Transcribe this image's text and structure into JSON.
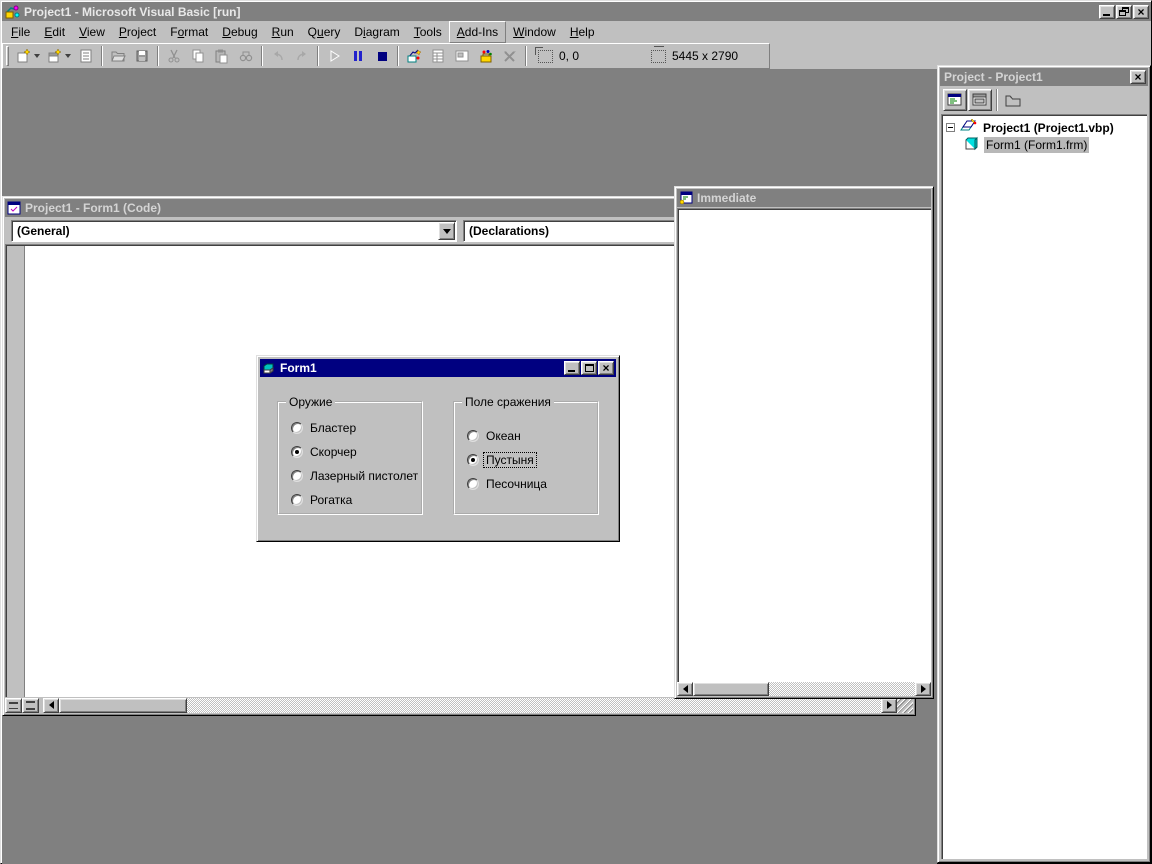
{
  "app": {
    "title": "Project1 - Microsoft Visual Basic [run]"
  },
  "menu": {
    "items": [
      {
        "label": "File",
        "underline": 0
      },
      {
        "label": "Edit",
        "underline": 0
      },
      {
        "label": "View",
        "underline": 0
      },
      {
        "label": "Project",
        "underline": 0
      },
      {
        "label": "Format",
        "underline": 1
      },
      {
        "label": "Debug",
        "underline": 0
      },
      {
        "label": "Run",
        "underline": 0
      },
      {
        "label": "Query",
        "underline": 1
      },
      {
        "label": "Diagram",
        "underline": 1
      },
      {
        "label": "Tools",
        "underline": 0
      },
      {
        "label": "Add-Ins",
        "underline": 0,
        "raised": true
      },
      {
        "label": "Window",
        "underline": 0
      },
      {
        "label": "Help",
        "underline": 0
      }
    ]
  },
  "toolbar": {
    "position_label": "0, 0",
    "size_label": "5445 x 2790",
    "buttons": [
      {
        "name": "add-project-button",
        "enabled": true
      },
      {
        "name": "add-form-button",
        "enabled": true
      },
      {
        "name": "menu-editor-button",
        "enabled": false
      },
      {
        "name": "open-project-button",
        "enabled": false
      },
      {
        "name": "save-project-button",
        "enabled": false
      },
      {
        "name": "cut-button",
        "enabled": false
      },
      {
        "name": "copy-button",
        "enabled": false
      },
      {
        "name": "paste-button",
        "enabled": false
      },
      {
        "name": "find-button",
        "enabled": false
      },
      {
        "name": "undo-button",
        "enabled": false
      },
      {
        "name": "redo-button",
        "enabled": false
      },
      {
        "name": "start-button",
        "enabled": false
      },
      {
        "name": "break-button",
        "enabled": true
      },
      {
        "name": "end-button",
        "enabled": true
      },
      {
        "name": "project-explorer-button",
        "enabled": true
      },
      {
        "name": "properties-window-button",
        "enabled": false
      },
      {
        "name": "form-layout-button",
        "enabled": false
      },
      {
        "name": "toolbox-button",
        "enabled": true
      },
      {
        "name": "object-browser-button",
        "enabled": false
      }
    ]
  },
  "code_window": {
    "title": "Project1 - Form1 (Code)",
    "object_combo": "(General)",
    "procedure_combo": "(Declarations)"
  },
  "immediate_window": {
    "title": "Immediate"
  },
  "form_window": {
    "title": "Form1",
    "weapon_group": {
      "label": "Оружие",
      "options": [
        {
          "label": "Бластер",
          "selected": false
        },
        {
          "label": "Скорчер",
          "selected": true
        },
        {
          "label": "Лазерный пистолет",
          "selected": false
        },
        {
          "label": "Рогатка",
          "selected": false
        }
      ]
    },
    "battlefield_group": {
      "label": "Поле сражения",
      "options": [
        {
          "label": "Океан",
          "selected": false
        },
        {
          "label": "Пустыня",
          "selected": true,
          "focused": true
        },
        {
          "label": "Песочница",
          "selected": false
        }
      ]
    }
  },
  "project_window": {
    "title": "Project - Project1",
    "project_node": "Project1 (Project1.vbp)",
    "form_node": "Form1 (Form1.frm)"
  },
  "icons": {
    "close_glyph": "×"
  },
  "colors": {
    "active_title": "#000080",
    "inactive_title": "#808080",
    "chrome": "#c0c0c0",
    "mdi_background": "#808080",
    "run_pause": "#2222cc",
    "run_stop": "#000080",
    "tree_selection": "#b8b8b8"
  }
}
